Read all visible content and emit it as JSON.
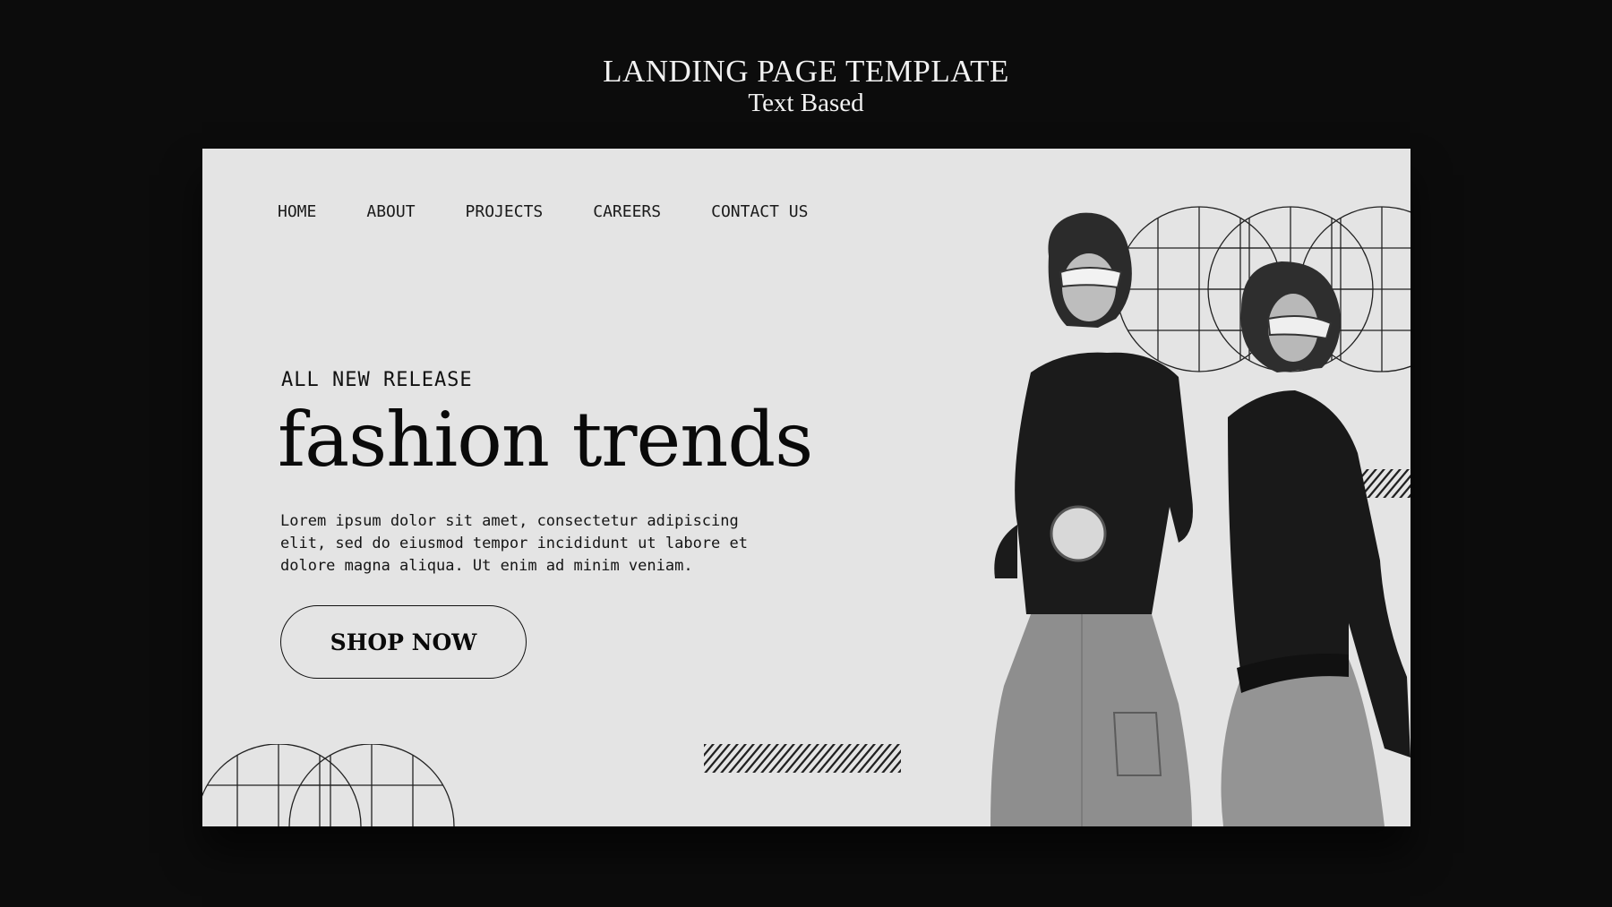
{
  "presentation": {
    "title": "LANDING PAGE TEMPLATE",
    "subtitle": "Text Based"
  },
  "nav": {
    "items": [
      {
        "label": "HOME"
      },
      {
        "label": "ABOUT"
      },
      {
        "label": "PROJECTS"
      },
      {
        "label": "CAREERS"
      },
      {
        "label": "CONTACT US"
      }
    ]
  },
  "hero": {
    "eyebrow": "ALL NEW RELEASE",
    "headline": "fashion trends",
    "body": "Lorem ipsum dolor sit amet, consectetur adipiscing elit, sed do eiusmod tempor incididunt ut labore et dolore magna aliqua. Ut enim ad minim veniam.",
    "cta_label": "SHOP NOW"
  },
  "colors": {
    "page_background": "#0c0c0c",
    "frame_background": "#e4e4e4",
    "ink": "#0a0a0a",
    "top_text": "#f2f2f2"
  }
}
